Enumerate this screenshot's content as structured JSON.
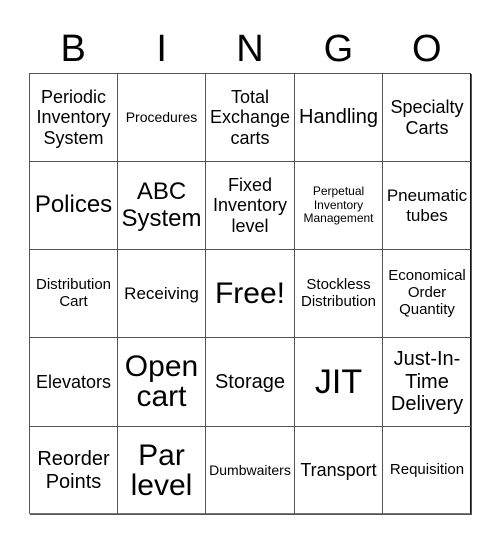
{
  "header": {
    "letters": [
      "B",
      "I",
      "N",
      "G",
      "O"
    ]
  },
  "cells": [
    [
      "Periodic Inventory System",
      "Procedures",
      "Total Exchange carts",
      "Handling",
      "Specialty Carts"
    ],
    [
      "Polices",
      "ABC System",
      "Fixed Inventory level",
      "Perpetual Inventory Management",
      "Pneumatic tubes"
    ],
    [
      "Distribution Cart",
      "Receiving",
      "Free!",
      "Stockless Distribution",
      "Economical Order Quantity"
    ],
    [
      "Elevators",
      "Open cart",
      "Storage",
      "JIT",
      "Just-In-Time Delivery"
    ],
    [
      "Reorder Points",
      "Par level",
      "Dumbwaiters",
      "Transport",
      "Requisition"
    ]
  ]
}
